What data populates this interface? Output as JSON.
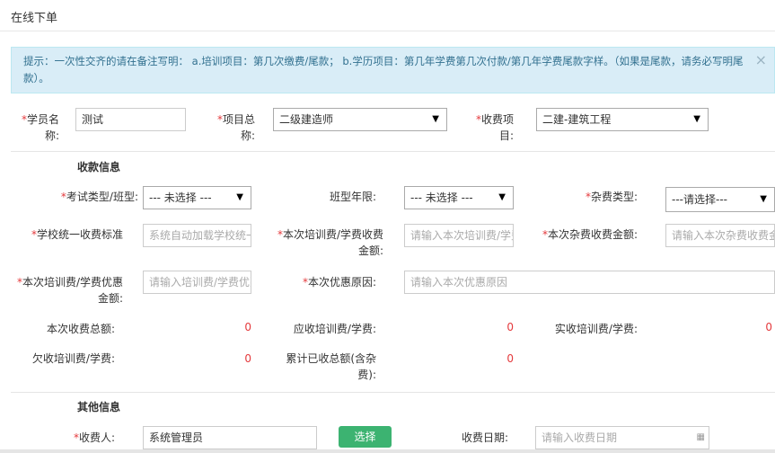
{
  "header": {
    "title": "在线下单"
  },
  "alert": {
    "text": "提示：一次性交齐的请在备注写明： a.培训项目：第几次缴费/尾款； b.学历项目：第几年学费第几次付款/第几年学费尾款字样。（如果是尾款，请务必写明尾款）。",
    "close": "×"
  },
  "form": {
    "student_label_1": "学员名",
    "student_label_2": "称:",
    "student_value": "测试",
    "project_label_1": "项目总",
    "project_label_2": "称:",
    "project_value": "二级建造师",
    "charge_label_1": "收费项",
    "charge_label_2": "目:",
    "charge_value": "二建-建筑工程"
  },
  "payment": {
    "section_title": "收款信息",
    "exam_type_label": "考试类型/班型:",
    "exam_type_value": "--- 未选择 ---",
    "class_year_label": "班型年限:",
    "class_year_value": "--- 未选择 ---",
    "misc_type_label": "杂费类型:",
    "misc_type_value": "---请选择---",
    "school_std_label": "学校统一收费标准",
    "school_std_placeholder": "系统自动加载学校统一收费标准",
    "this_fee_label_1": "本次培训费/学费收费",
    "this_fee_label_2": "金额:",
    "this_fee_placeholder": "请输入本次培训费/学费收费金额",
    "this_misc_label": "本次杂费收费金额:",
    "this_misc_placeholder": "请输入本次杂费收费金额",
    "discount_label_1": "本次培训费/学费优惠",
    "discount_label_2": "金额:",
    "discount_placeholder": "请输入培训费/学费优惠金额",
    "discount_reason_label": "本次优惠原因:",
    "discount_reason_placeholder": "请输入本次优惠原因",
    "total_label": "本次收费总额:",
    "total_value": "0",
    "receivable_label": "应收培训费/学费:",
    "receivable_value": "0",
    "actual_label": "实收培训费/学费:",
    "actual_value": "0",
    "owed_label": "欠收培训费/学费:",
    "owed_value": "0",
    "cumulative_label_1": "累计已收总额(含杂",
    "cumulative_label_2": "费):",
    "cumulative_value": "0"
  },
  "other": {
    "section_title": "其他信息",
    "payee_label": "收费人:",
    "payee_value": "系统管理员",
    "choose_button": "选择",
    "date_label": "收费日期:",
    "date_placeholder": "请输入收费日期"
  },
  "required_mark": "*"
}
